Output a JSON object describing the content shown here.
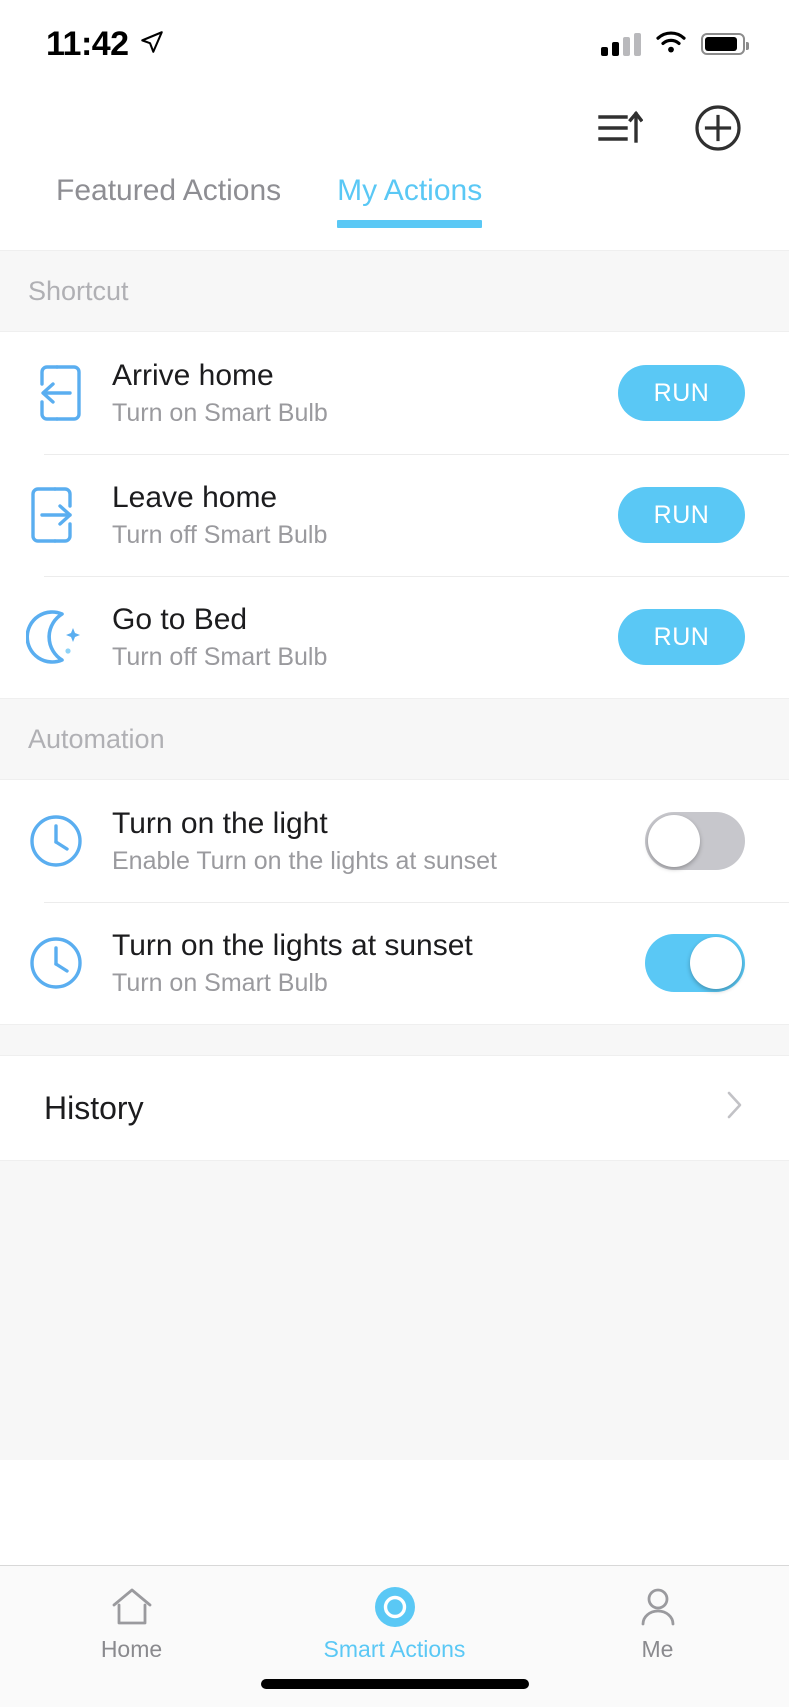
{
  "status_bar": {
    "time": "11:42",
    "location_icon": "location-arrow-icon",
    "signal_icon": "cellular-signal-icon",
    "wifi_icon": "wifi-icon",
    "battery_icon": "battery-icon"
  },
  "header": {
    "sort_icon": "sort-list-icon",
    "add_icon": "add-circle-icon"
  },
  "tabs": [
    {
      "label": "Featured Actions",
      "active": false
    },
    {
      "label": "My Actions",
      "active": true
    }
  ],
  "sections": [
    {
      "title": "Shortcut",
      "rows": [
        {
          "icon": "arrive-home-icon",
          "title": "Arrive home",
          "subtitle": "Turn on Smart Bulb",
          "control": "run",
          "run_label": "RUN"
        },
        {
          "icon": "leave-home-icon",
          "title": "Leave home",
          "subtitle": "Turn off Smart Bulb",
          "control": "run",
          "run_label": "RUN"
        },
        {
          "icon": "moon-icon",
          "title": "Go to Bed",
          "subtitle": "Turn off Smart Bulb",
          "control": "run",
          "run_label": "RUN"
        }
      ]
    },
    {
      "title": "Automation",
      "rows": [
        {
          "icon": "clock-icon",
          "title": "Turn on the light",
          "subtitle": "Enable Turn on the lights at sunset",
          "control": "toggle",
          "toggle_on": false
        },
        {
          "icon": "clock-icon",
          "title": "Turn on the lights at sunset",
          "subtitle": "Turn on Smart Bulb",
          "control": "toggle",
          "toggle_on": true
        }
      ]
    }
  ],
  "history": {
    "label": "History",
    "chevron": "chevron-right-icon"
  },
  "bottom_nav": [
    {
      "label": "Home",
      "icon": "home-icon",
      "active": false
    },
    {
      "label": "Smart Actions",
      "icon": "smart-actions-circle-icon",
      "active": true
    },
    {
      "label": "Me",
      "icon": "person-icon",
      "active": false
    }
  ],
  "colors": {
    "accent": "#5ac8f5",
    "text_primary": "#1c1c1e",
    "text_secondary": "#9a9a9e",
    "section_header_text": "#b0b0b4",
    "toggle_off": "#c7c7cc",
    "background": "#f7f7f7"
  }
}
